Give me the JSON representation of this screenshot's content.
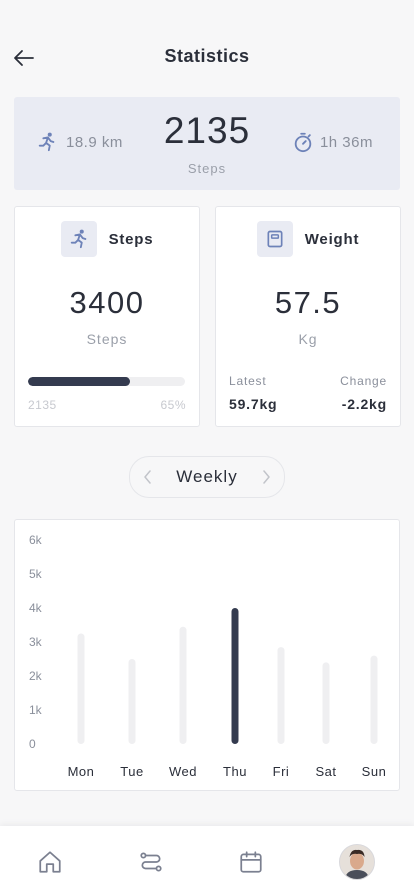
{
  "header": {
    "title": "Statistics"
  },
  "summary": {
    "distance": "18.9 km",
    "steps": "2135",
    "steps_label": "Steps",
    "duration": "1h 36m"
  },
  "steps_card": {
    "title": "Steps",
    "value": "3400",
    "unit": "Steps",
    "progress_current": "2135",
    "progress_percent_label": "65%",
    "progress_fraction": 0.65
  },
  "weight_card": {
    "title": "Weight",
    "value": "57.5",
    "unit": "Kg",
    "latest_label": "Latest",
    "latest_value": "59.7kg",
    "change_label": "Change",
    "change_value": "-2.2kg"
  },
  "period": {
    "label": "Weekly"
  },
  "chart_data": {
    "type": "bar",
    "categories": [
      "Mon",
      "Tue",
      "Wed",
      "Thu",
      "Fri",
      "Sat",
      "Sun"
    ],
    "values": [
      3250,
      2500,
      3450,
      4000,
      2850,
      2400,
      2600
    ],
    "highlight_index": 3,
    "y_ticks": [
      "0",
      "1k",
      "2k",
      "3k",
      "4k",
      "5k",
      "6k"
    ],
    "ylim": [
      0,
      6000
    ],
    "colors": {
      "bar": "#efeff1",
      "highlight": "#343b4f"
    }
  },
  "tabs": [
    {
      "name": "home-icon"
    },
    {
      "name": "route-icon"
    },
    {
      "name": "calendar-icon"
    },
    {
      "name": "avatar"
    }
  ]
}
